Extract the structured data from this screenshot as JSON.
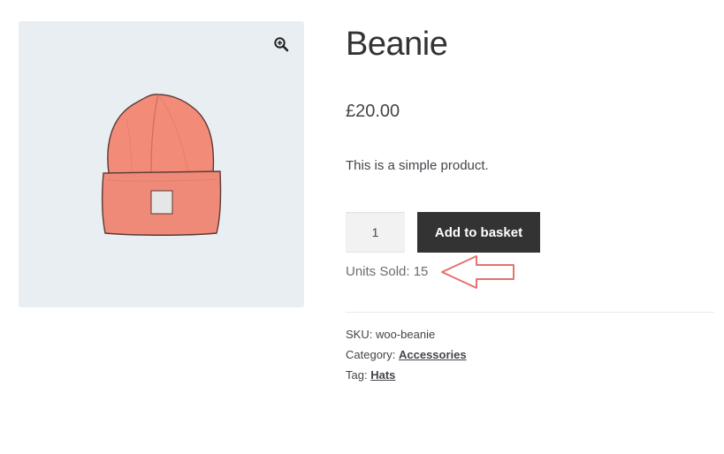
{
  "product": {
    "title": "Beanie",
    "price": "£20.00",
    "description": "This is a simple product.",
    "quantity": "1",
    "add_to_basket_label": "Add to basket",
    "units_sold_label": "Units Sold: 15"
  },
  "meta": {
    "sku_label": "SKU:",
    "sku_value": "woo-beanie",
    "category_label": "Category:",
    "category_value": "Accessories",
    "tag_label": "Tag:",
    "tag_value": "Hats"
  },
  "icons": {
    "zoom": "magnifier-plus-icon",
    "annotation": "left-arrow-icon"
  },
  "colors": {
    "button_bg": "#333333",
    "gallery_bg": "#e9eef3",
    "beanie": "#f08a78",
    "arrow": "#e5726e"
  }
}
